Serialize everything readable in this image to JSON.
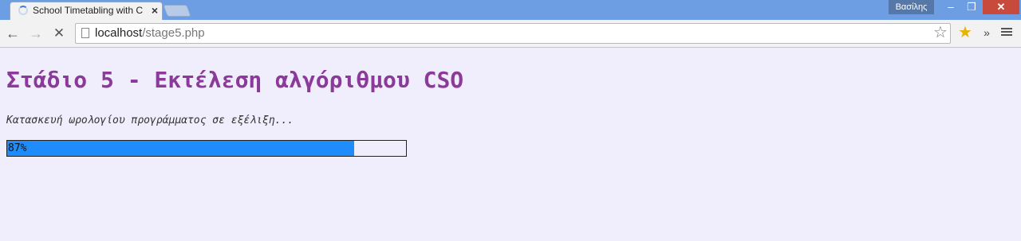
{
  "browser": {
    "tab": {
      "title": "School Timetabling with C"
    },
    "user_name": "Βασίλης",
    "address": {
      "host": "localhost",
      "path": "/stage5.php"
    }
  },
  "icons": {
    "back": "back-arrow-icon",
    "forward": "forward-arrow-icon",
    "stop": "stop-loading-icon",
    "page": "page-icon",
    "bookmark": "star-icon",
    "extension": "extension-star-icon",
    "overflow": "chevron-more-icon",
    "menu": "hamburger-menu-icon"
  },
  "page": {
    "title": "Στάδιο 5 - Εκτέλεση αλγόριθμου CSO",
    "status": "Κατασκευή ωρολογίου προγράμματος σε εξέλιξη...",
    "progress": {
      "percent": 87,
      "label": "87%"
    }
  },
  "colors": {
    "title": "#8b3a9a",
    "progress_fill": "#1e8cfb",
    "page_background": "#f0eefd",
    "titlebar": "#6d9ee3"
  }
}
